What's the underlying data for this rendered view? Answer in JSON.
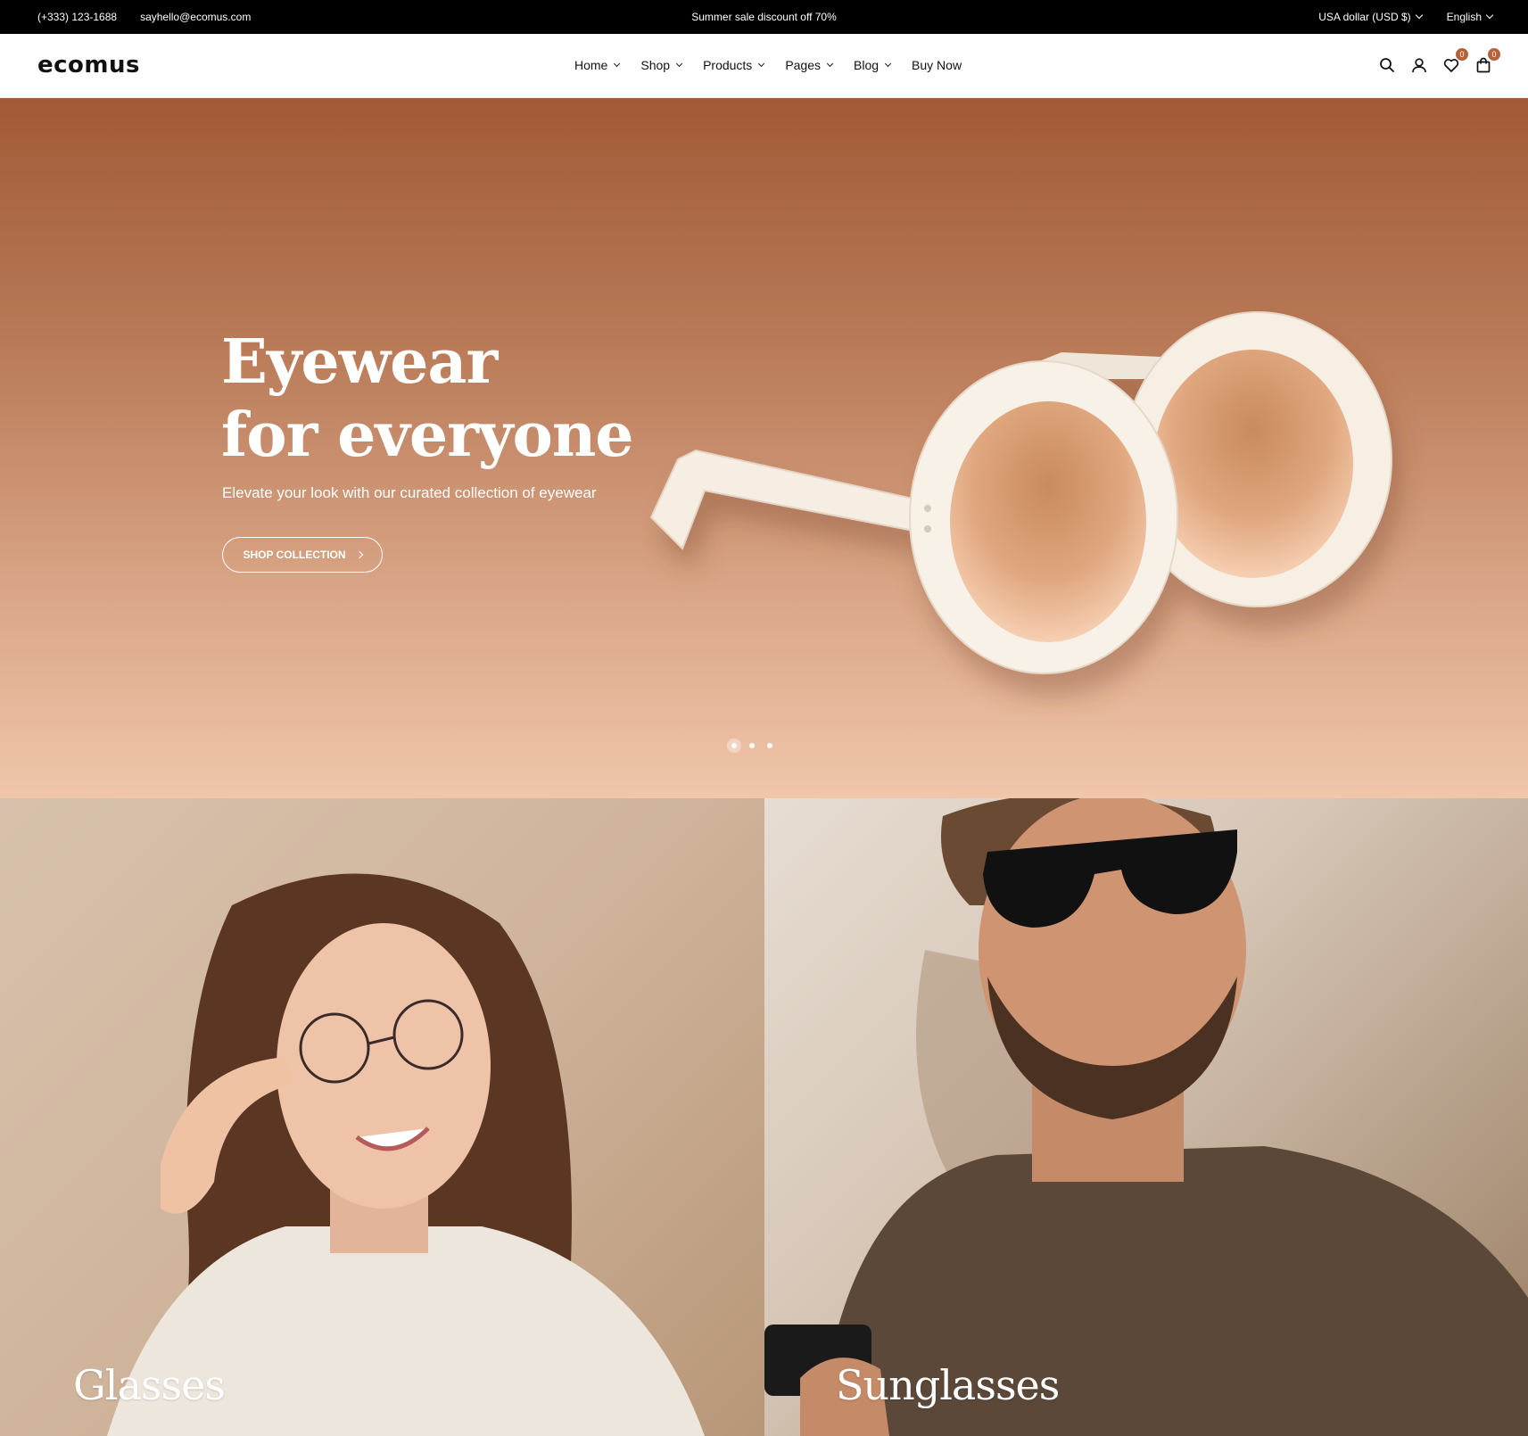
{
  "topbar": {
    "phone": "(+333) 123-1688",
    "email": "sayhello@ecomus.com",
    "announcement": "Summer sale discount off 70%",
    "currency": "USA dollar (USD $)",
    "language": "English"
  },
  "header": {
    "logo": "ecomus",
    "nav": [
      {
        "label": "Home"
      },
      {
        "label": "Shop"
      },
      {
        "label": "Products"
      },
      {
        "label": "Pages"
      },
      {
        "label": "Blog"
      },
      {
        "label": "Buy Now"
      }
    ],
    "wishlist_count": "0",
    "cart_count": "0",
    "icons": [
      "search-icon",
      "user-icon",
      "heart-icon",
      "bag-icon"
    ]
  },
  "hero": {
    "title_line1": "Eyewear",
    "title_line2": "for everyone",
    "subtitle": "Elevate your look with our curated collection of eyewear",
    "cta": "SHOP COLLECTION",
    "slides": 3,
    "active_slide": 1
  },
  "categories": [
    {
      "label": "Glasses"
    },
    {
      "label": "Sunglasses"
    }
  ],
  "colors": {
    "accent": "#b5623a",
    "hero_top": "#a15a36",
    "hero_bottom": "#f1c6aa"
  }
}
